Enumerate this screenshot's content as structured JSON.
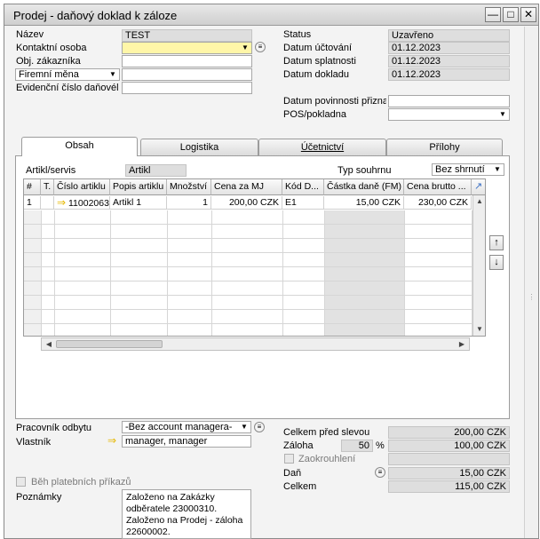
{
  "window": {
    "title": "Prodej - daňový doklad k záloze"
  },
  "header_left": {
    "name_label": "Název",
    "name_value": "TEST",
    "contact_label": "Kontaktní osoba",
    "contact_value": "",
    "order_label": "Obj. zákazníka",
    "order_value": "",
    "currency_select": "Firemní měna",
    "currency_value": "",
    "vat_label": "Evidenční číslo daňovél",
    "vat_value": ""
  },
  "header_right": {
    "status_label": "Status",
    "status_value": "Uzavřeno",
    "posting_date_label": "Datum účtování",
    "posting_date_value": "01.12.2023",
    "due_date_label": "Datum splatnosti",
    "due_date_value": "01.12.2023",
    "doc_date_label": "Datum dokladu",
    "doc_date_value": "01.12.2023",
    "tax_date_label": "Datum povinnosti přiznat d",
    "tax_date_value": "",
    "pos_label": "POS/pokladna",
    "pos_value": ""
  },
  "tabs": [
    "Obsah",
    "Logistika",
    "Účetnictví",
    "Přílohy"
  ],
  "content": {
    "item_service_label": "Artikl/servis",
    "item_service_value": "Artikl",
    "summary_type_label": "Typ souhrnu",
    "summary_type_value": "Bez shrnutí",
    "columns": [
      "#",
      "T.",
      "Číslo artiklu",
      "Popis artiklu",
      "Množství",
      "Cena za MJ",
      "Kód D...",
      "Částka daně (FM)",
      "Cena brutto ..."
    ],
    "rows": [
      {
        "num": "1",
        "type": "",
        "item_no": "11002063",
        "desc": "Artikl 1",
        "qty": "1",
        "price": "200,00 CZK",
        "tax_code": "E1",
        "tax_amount": "15,00 CZK",
        "gross": "230,00 CZK"
      }
    ]
  },
  "footer_left": {
    "employee_label": "Pracovník odbytu",
    "employee_value": "-Bez account managera-",
    "owner_label": "Vlastník",
    "owner_value": "manager, manager",
    "payment_run_label": "Běh platebních příkazů",
    "remarks_label": "Poznámky",
    "remarks_value": "Založeno na Zakázky odběratele 23000310. Založeno na Prodej - záloha 22600002."
  },
  "footer_right": {
    "before_discount_label": "Celkem před slevou",
    "before_discount_value": "200,00 CZK",
    "deposit_label": "Záloha",
    "deposit_pct": "50",
    "deposit_pct_sign": "%",
    "deposit_value": "100,00 CZK",
    "rounding_label": "Zaokrouhlení",
    "tax_label": "Daň",
    "tax_value": "15,00 CZK",
    "total_label": "Celkem",
    "total_value": "115,00 CZK"
  }
}
